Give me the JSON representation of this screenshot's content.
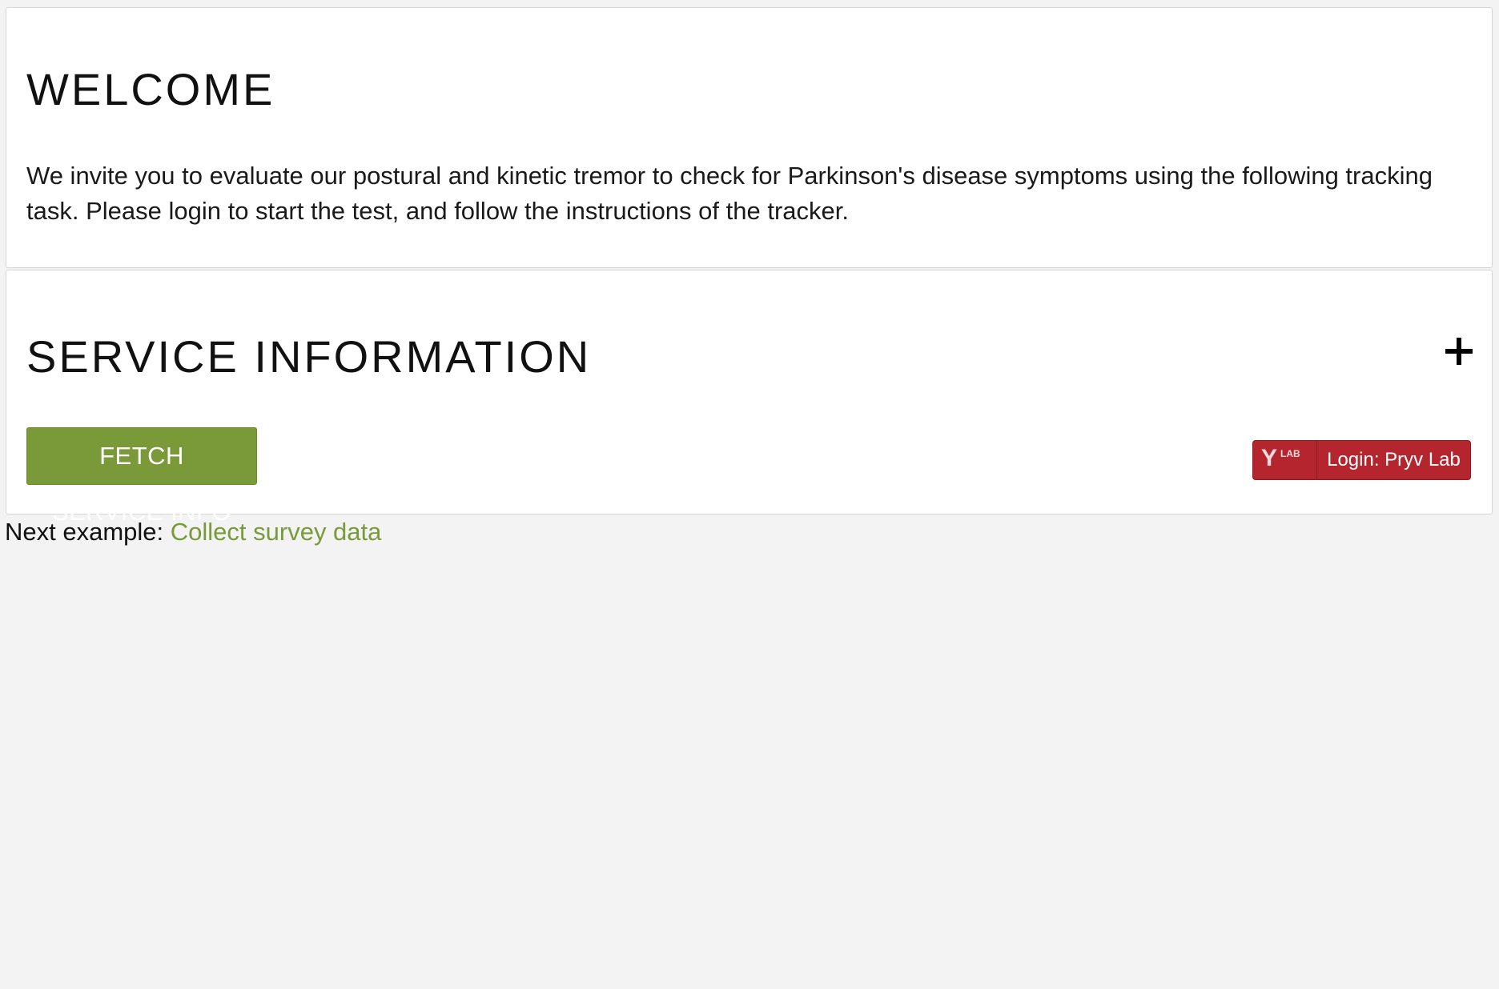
{
  "welcome": {
    "title": "WELCOME",
    "text": "We invite you to evaluate our postural and kinetic tremor to check for Parkinson's disease symptoms using the following tracking task. Please login to start the test, and follow the instructions of the tracker."
  },
  "service": {
    "title": "SERVICE INFORMATION",
    "toggle_icon": "plus-icon",
    "fetch_label": "FETCH SERVICE INFO",
    "login": {
      "logo_letter": "Y",
      "logo_sup": "LAB",
      "label": "Login: Pryv Lab"
    }
  },
  "footer": {
    "prefix": "Next example: ",
    "link_text": "Collect survey data"
  },
  "colors": {
    "background": "#f3f3f3",
    "accent_green": "#7a9a3a",
    "login_red": "#b5252e"
  }
}
